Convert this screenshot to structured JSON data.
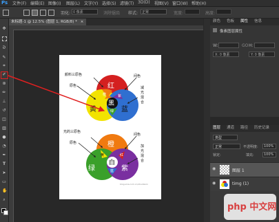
{
  "menubar": {
    "logo": "Ps",
    "items": [
      "文件(F)",
      "编辑(E)",
      "图像(I)",
      "图层(L)",
      "文字(Y)",
      "选择(S)",
      "滤镜(T)",
      "3D(D)",
      "视图(V)",
      "窗口(W)",
      "帮助(H)"
    ]
  },
  "options": {
    "feather_label": "羽化:",
    "feather_value": "0 像素",
    "antialias_label": "消除锯齿",
    "style_label": "样式:",
    "style_value": "正常",
    "width_label": "宽度:",
    "height_label": "高度:"
  },
  "document": {
    "tab_title": "未标题-1 @ 12.5% (图层 1, RGB/8) *",
    "close": "×"
  },
  "rgb_diagram": {
    "title": "颜料三原色",
    "label_red": "红",
    "label_yellow": "黄",
    "label_blue": "蓝",
    "label_black": "黑",
    "label_orange": "橙",
    "label_green": "绿",
    "label_purple": "紫",
    "annot_intermediate": "间色",
    "annot_primary": "原色",
    "annot_mix": "减光混合"
  },
  "light_diagram": {
    "title": "光的三原色",
    "label_orange": "橙",
    "label_green": "绿",
    "label_purple": "紫",
    "label_white": "白",
    "label_yellow": "黄",
    "label_red": "红",
    "label_blue": "蓝",
    "annot_intermediate": "间色",
    "annot_primary": "原色",
    "annot_mix": "加光混合",
    "credit": "blog.sina.com.cn/shuidaxin"
  },
  "properties_panel": {
    "tabs": [
      "颜色",
      "色板",
      "属性",
      "信息"
    ],
    "header": "像素图层属性",
    "w_label": "W:",
    "h_label": "H:",
    "x_label": "X: 0 像素",
    "y_label": "Y: 0 像素",
    "link_label": "GO"
  },
  "layers_panel": {
    "tabs": [
      "图层",
      "通道",
      "路径",
      "历史记录"
    ],
    "kind_label": "类型",
    "blend_mode": "正常",
    "opacity_label": "不透明度:",
    "opacity_value": "100%",
    "lock_label": "锁定:",
    "fill_label": "填充:",
    "fill_value": "100%",
    "layers": [
      {
        "name": "图层 1",
        "selected": true
      },
      {
        "name": "timg (1)",
        "selected": false
      }
    ]
  },
  "watermark": {
    "text": "php 中文网"
  },
  "colors": {
    "red": "#d42020",
    "yellow": "#f2e300",
    "blue": "#2f6fd0",
    "orange": "#f07a10",
    "green": "#3aa02a",
    "purple": "#7a2fa0",
    "highlight": "#e02020"
  }
}
